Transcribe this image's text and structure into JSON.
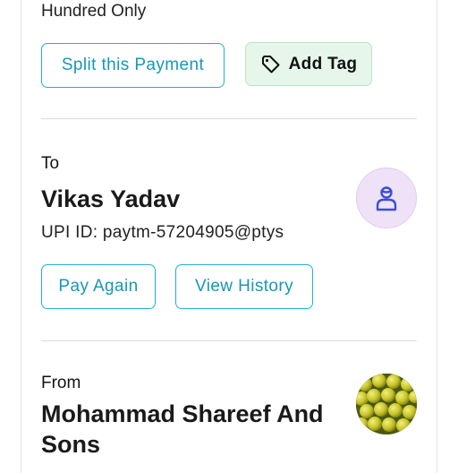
{
  "payment": {
    "amount_words": "Hundred Only",
    "split_label": "Split this Payment",
    "tag_label": "Add Tag"
  },
  "to": {
    "label": "To",
    "name": "Vikas Yadav",
    "upi": "UPI ID: paytm-57204905@ptys",
    "pay_again_label": "Pay Again",
    "view_history_label": "View History",
    "avatar_icon": "person-icon"
  },
  "from": {
    "label": "From",
    "name": "Mohammad Shareef And Sons",
    "avatar_icon": "merchant-photo"
  },
  "colors": {
    "accent": "#20b0ce",
    "tag_bg": "#e6f6ea",
    "avatar_bg": "#efe1f8"
  }
}
